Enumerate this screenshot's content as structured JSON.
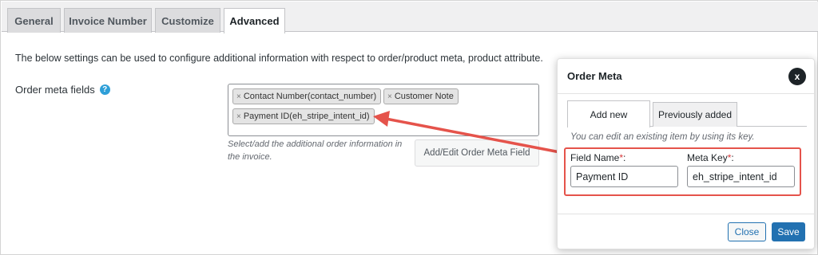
{
  "tabs": [
    {
      "label": "General"
    },
    {
      "label": "Invoice Number"
    },
    {
      "label": "Customize"
    },
    {
      "label": "Advanced"
    }
  ],
  "description": "The below settings can be used to configure additional information with respect to order/product meta, product attribute.",
  "order_meta": {
    "label": "Order meta fields",
    "help_icon": "?",
    "chips": [
      {
        "label": "Contact Number(contact_number)"
      },
      {
        "label": "Customer Note"
      },
      {
        "label": "Payment ID(eh_stripe_intent_id)"
      }
    ],
    "chip_remove": "×",
    "help_text": "Select/add the additional order information in the invoice.",
    "add_edit_button": "Add/Edit Order Meta Field"
  },
  "modal": {
    "title": "Order Meta",
    "close_icon": "x",
    "tabs": [
      {
        "label": "Add new"
      },
      {
        "label": "Previously added"
      }
    ],
    "hint": "You can edit an existing item by using its key.",
    "field_name_label": "Field Name",
    "meta_key_label": "Meta Key",
    "required_mark": "*",
    "label_suffix": ":",
    "field_name_value": "Payment ID",
    "meta_key_value": "eh_stripe_intent_id",
    "close_button": "Close",
    "save_button": "Save"
  },
  "colors": {
    "accent": "#2271b1",
    "highlight": "#e5534b",
    "help_icon": "#2e9fd8"
  }
}
